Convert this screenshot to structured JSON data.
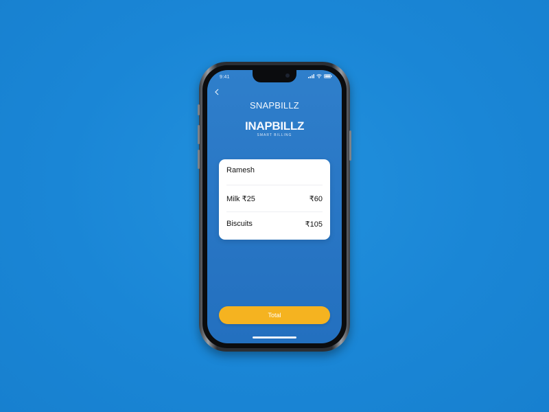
{
  "status_bar": {
    "time": "9:41",
    "icons": [
      "signal-icon",
      "wifi-icon",
      "battery-icon"
    ]
  },
  "nav": {
    "back_icon": "chevron-left-icon"
  },
  "header": {
    "title": "SNAPBILLZ"
  },
  "brand": {
    "logo_text": "INAPBILLZ",
    "tagline": "SMART BILLING"
  },
  "bill": {
    "customer": "Ramesh",
    "items": [
      {
        "name": "Milk ₹25",
        "price": "₹60"
      },
      {
        "name": "Biscuits",
        "price": "₹105"
      }
    ]
  },
  "actions": {
    "total_label": "Total"
  },
  "colors": {
    "background": "#1a86d6",
    "screen": "#2a78c6",
    "card": "#ffffff",
    "accent": "#f5b320"
  }
}
